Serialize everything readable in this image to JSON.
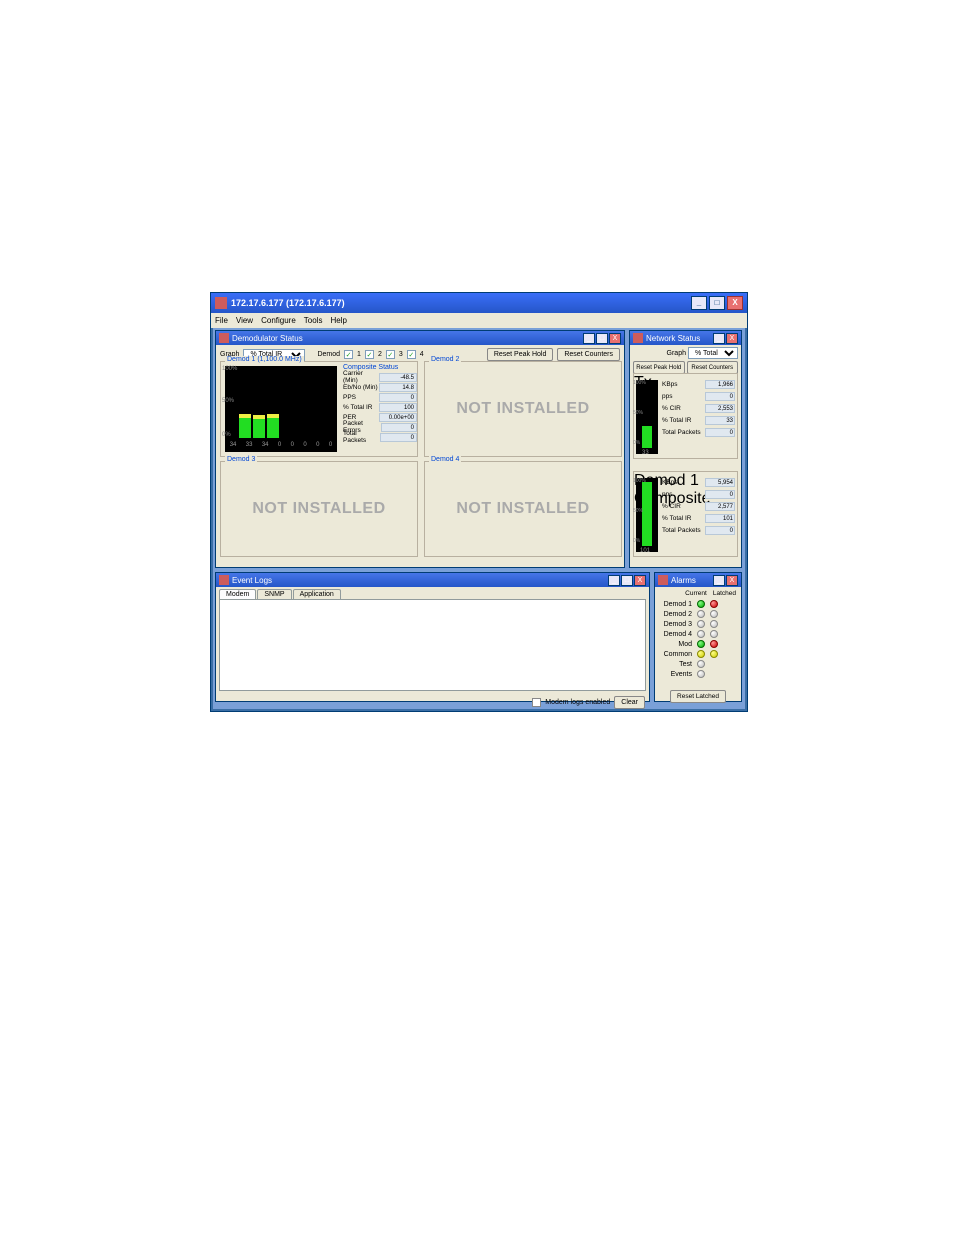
{
  "window": {
    "title": "172.17.6.177 (172.17.6.177)"
  },
  "menu": [
    "File",
    "View",
    "Configure",
    "Tools",
    "Help"
  ],
  "demodStatus": {
    "title": "Demodulator Status",
    "graphLabel": "Graph",
    "graphSel": "% Total IR",
    "demodLabel": "Demod",
    "checks": [
      "1",
      "2",
      "3",
      "4"
    ],
    "resetPeakBtn": "Reset Peak Hold",
    "resetCountersBtn": "Reset Counters",
    "d1": {
      "legend": "Demod 1 (1,100.0 MHz)",
      "ylabels": [
        "100%",
        "50%",
        "0%"
      ],
      "xlabels": [
        "34",
        "33",
        "34",
        "0",
        "0",
        "0",
        "0",
        "0"
      ],
      "compTitle": "Composite Status",
      "rows": [
        {
          "k": "Carrier (Min)",
          "v": "-48.5"
        },
        {
          "k": "Eb/No (Min)",
          "v": "14.8"
        },
        {
          "k": "PPS",
          "v": "0"
        },
        {
          "k": "% Total IR",
          "v": "100"
        },
        {
          "k": "PER",
          "v": "0.00e+00"
        },
        {
          "k": "Packet Errors",
          "v": "0"
        },
        {
          "k": "Total Packets",
          "v": "0"
        }
      ]
    },
    "d2": {
      "legend": "Demod 2",
      "text": "NOT INSTALLED"
    },
    "d3": {
      "legend": "Demod 3",
      "text": "NOT INSTALLED"
    },
    "d4": {
      "legend": "Demod 4",
      "text": "NOT INSTALLED"
    }
  },
  "netStatus": {
    "title": "Network Status",
    "graphLabel": "Graph",
    "graphSel": "% Total IR",
    "resetPeakBtn": "Reset Peak Hold",
    "resetCountersBtn": "Reset Counters",
    "tx": {
      "legend": "Tx",
      "ylabels": [
        "100%",
        "50%",
        "0%"
      ],
      "xval": "33",
      "rows": [
        {
          "k": "KBps",
          "v": "1,966"
        },
        {
          "k": "pps",
          "v": "0"
        },
        {
          "k": "% CIR",
          "v": "2,553"
        },
        {
          "k": "% Total IR",
          "v": "33"
        },
        {
          "k": "Total Packets",
          "v": "0"
        }
      ]
    },
    "d1c": {
      "legend": "Demod 1 Composite",
      "ylabels": [
        "100%",
        "50%",
        "0%"
      ],
      "xval": "101",
      "rows": [
        {
          "k": "KBps",
          "v": "5,954"
        },
        {
          "k": "pps",
          "v": "0"
        },
        {
          "k": "% CIR",
          "v": "2,577"
        },
        {
          "k": "% Total IR",
          "v": "101"
        },
        {
          "k": "Total Packets",
          "v": "0"
        }
      ]
    }
  },
  "eventLogs": {
    "title": "Event Logs",
    "tabs": [
      "Modem",
      "SNMP",
      "Application"
    ],
    "modemLogsLabel": "Modem logs enabled",
    "clearBtn": "Clear"
  },
  "alarms": {
    "title": "Alarms",
    "hdr": [
      "Current",
      "Latched"
    ],
    "rows": [
      {
        "lbl": "Demod 1",
        "c": "green",
        "l": "red"
      },
      {
        "lbl": "Demod 2",
        "c": "grey",
        "l": "grey"
      },
      {
        "lbl": "Demod 3",
        "c": "grey",
        "l": "grey"
      },
      {
        "lbl": "Demod 4",
        "c": "grey",
        "l": "grey"
      },
      {
        "lbl": "Mod",
        "c": "green",
        "l": "red"
      },
      {
        "lbl": "Common",
        "c": "yellow",
        "l": "yellow"
      },
      {
        "lbl": "Test",
        "c": "grey",
        "l": ""
      },
      {
        "lbl": "Events",
        "c": "grey",
        "l": ""
      }
    ],
    "resetBtn": "Reset Latched"
  }
}
